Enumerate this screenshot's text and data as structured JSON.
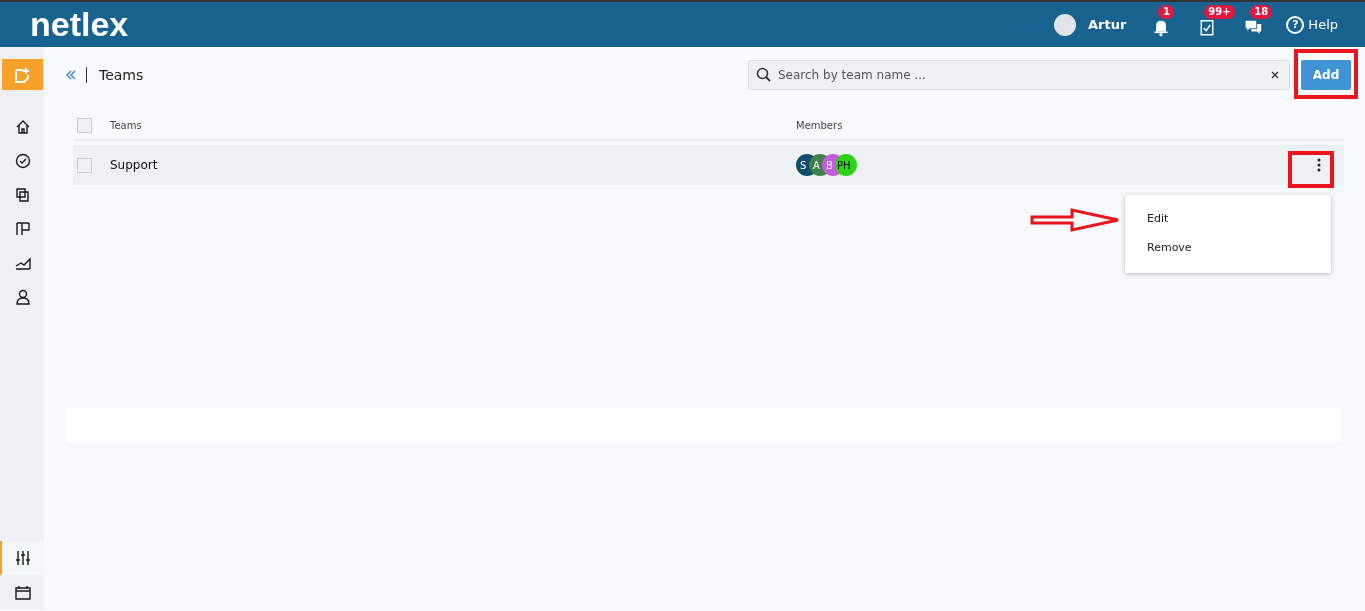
{
  "header": {
    "logo": "netlex",
    "user": "Artur",
    "notifications": [
      {
        "kind": "bell",
        "count": "1"
      },
      {
        "kind": "tasks",
        "count": "99+"
      },
      {
        "kind": "chat",
        "count": "18"
      }
    ],
    "help_icon": "?",
    "help": "Help"
  },
  "sidebar": {
    "items": [
      {
        "kind": "home",
        "selected": false
      },
      {
        "kind": "check",
        "selected": false
      },
      {
        "kind": "docs",
        "selected": false
      },
      {
        "kind": "board",
        "selected": false
      },
      {
        "kind": "chart",
        "selected": false
      },
      {
        "kind": "person",
        "selected": false
      }
    ],
    "bottom_items": [
      {
        "kind": "sliders",
        "selected": true
      },
      {
        "kind": "calendar",
        "selected": false
      }
    ]
  },
  "page": {
    "title": "Teams",
    "search": {
      "placeholder": "Search by team name ..."
    },
    "add_button": "Add"
  },
  "table": {
    "select_all_checked": false,
    "columns": [
      "Teams",
      "Members"
    ],
    "rows": [
      {
        "name": "Support",
        "checked": false,
        "members": [
          {
            "initials": "S",
            "color": "#0f4c6e"
          },
          {
            "initials": "A",
            "color": "#3e7f4a"
          },
          {
            "initials": "B",
            "color": "#c45ddc"
          },
          {
            "initials": "PH",
            "color": "#2fd019"
          }
        ]
      }
    ]
  },
  "menu": {
    "items": [
      "Edit",
      "Remove"
    ]
  }
}
